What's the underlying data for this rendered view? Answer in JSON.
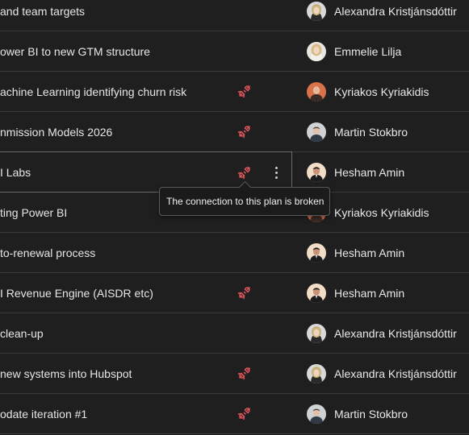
{
  "rows": [
    {
      "name": "and team targets",
      "owner": "Alexandra Kristjánsdóttir",
      "avatar": "avatar-woman-blonde-grey",
      "broken": false
    },
    {
      "name": "ower BI to new GTM structure",
      "owner": "Emmelie Lilja",
      "avatar": "avatar-woman-blonde-light",
      "broken": false
    },
    {
      "name": "achine Learning identifying churn risk",
      "owner": "Kyriakos Kyriakidis",
      "avatar": "avatar-man-orange",
      "broken": true
    },
    {
      "name": "nmission Models 2026",
      "owner": "Martin Stokbro",
      "avatar": "avatar-man-grey",
      "broken": true
    },
    {
      "name": "I Labs",
      "owner": "Hesham Amin",
      "avatar": "avatar-man-suit",
      "broken": true,
      "selected": true
    },
    {
      "name": "ting Power BI",
      "owner": "Kyriakos Kyriakidis",
      "avatar": "avatar-man-orange",
      "broken": false
    },
    {
      "name": "to-renewal process",
      "owner": "Hesham Amin",
      "avatar": "avatar-man-suit",
      "broken": false
    },
    {
      "name": "I Revenue Engine (AISDR etc)",
      "owner": "Hesham Amin",
      "avatar": "avatar-man-suit",
      "broken": true
    },
    {
      "name": "clean-up",
      "owner": "Alexandra Kristjánsdóttir",
      "avatar": "avatar-woman-blonde-grey",
      "broken": false
    },
    {
      "name": "new systems into Hubspot",
      "owner": "Alexandra Kristjánsdóttir",
      "avatar": "avatar-woman-blonde-grey",
      "broken": true
    },
    {
      "name": "odate iteration #1",
      "owner": "Martin Stokbro",
      "avatar": "avatar-man-grey",
      "broken": true
    }
  ],
  "tooltip": {
    "text": "The connection to this plan is broken"
  },
  "colors": {
    "background": "#1f1f1f",
    "broken_icon": "#e0565b",
    "divider": "#3a3a3a"
  },
  "icons": {
    "broken": "broken-link-icon",
    "more": "more-vertical-icon"
  }
}
